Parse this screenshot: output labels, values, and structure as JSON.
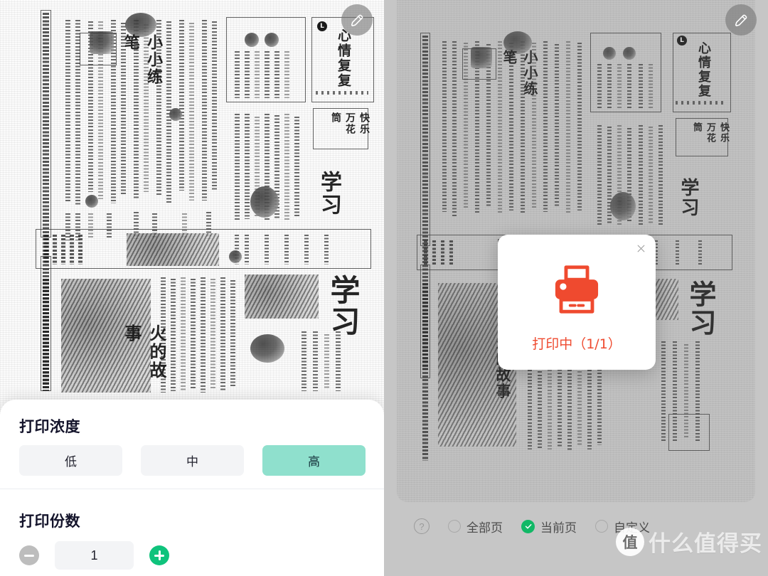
{
  "app": {
    "accent_green": "#0fc37c",
    "selected_chip_green": "#8fe0cd",
    "print_red": "#ef4a2f",
    "radio_green": "#11b866"
  },
  "left_panel": {
    "edit_button": {
      "icon": "pencil-icon",
      "label": "编辑"
    },
    "sheet": {
      "density": {
        "title": "打印浓度",
        "options": [
          {
            "label": "低",
            "selected": false
          },
          {
            "label": "中",
            "selected": false
          },
          {
            "label": "高",
            "selected": true
          }
        ]
      },
      "copies": {
        "title": "打印份数",
        "decrement_label": "−",
        "increment_label": "+",
        "value": "1"
      }
    }
  },
  "right_panel": {
    "edit_button": {
      "icon": "pencil-icon",
      "label": "编辑"
    },
    "dialog": {
      "icon": "printer-icon",
      "status_text": "打印中（1/1）",
      "close_label": "关闭"
    },
    "bottom_bar": {
      "help_label": "?",
      "options": [
        {
          "label": "全部页",
          "selected": false
        },
        {
          "label": "当前页",
          "selected": true
        },
        {
          "label": "自定义",
          "selected": false
        }
      ]
    }
  },
  "watermark": {
    "badge": "值",
    "text": "什么值得买"
  },
  "document": {
    "type": "scanned-newspaper",
    "masthead_chars": "小小练笔",
    "column_count": 14
  }
}
